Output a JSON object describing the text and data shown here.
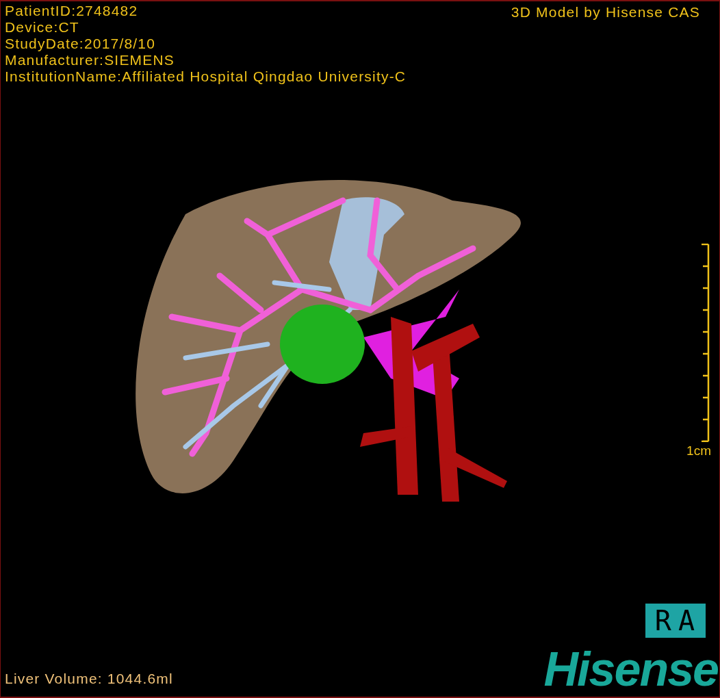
{
  "info_lines": [
    "PatientID:2748482",
    "Device:CT",
    "StudyDate:2017/8/10",
    "Manufacturer:SIEMENS",
    "InstitutionName:Affiliated Hospital Qingdao University-C"
  ],
  "title": "3D Model by Hisense CAS",
  "scale_bar": {
    "label": "1cm"
  },
  "orientation": "RA",
  "liver_volume": "Liver Volume: 1044.6ml",
  "logo": "Hisense"
}
